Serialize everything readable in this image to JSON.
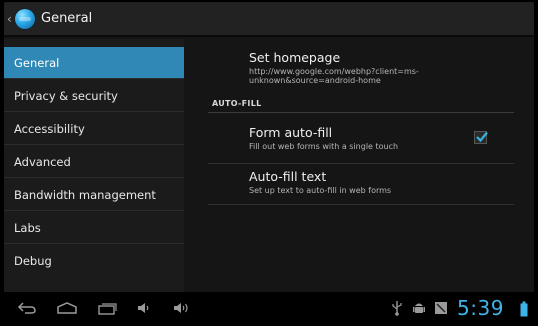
{
  "action_bar": {
    "title": "General"
  },
  "sidebar": {
    "items": [
      {
        "label": "General",
        "active": true
      },
      {
        "label": "Privacy & security"
      },
      {
        "label": "Accessibility"
      },
      {
        "label": "Advanced"
      },
      {
        "label": "Bandwidth management"
      },
      {
        "label": "Labs"
      },
      {
        "label": "Debug"
      }
    ]
  },
  "preferences": {
    "homepage": {
      "title": "Set homepage",
      "summary": "http://www.google.com/webhp?client=ms-unknown&source=android-home"
    },
    "category_autofill": "AUTO-FILL",
    "form_autofill": {
      "title": "Form auto-fill",
      "summary": "Fill out web forms with a single touch",
      "checked": true
    },
    "autofill_text": {
      "title": "Auto-fill text",
      "summary": "Set up text to auto-fill in web forms"
    }
  },
  "status_bar": {
    "time": "5:39"
  },
  "colors": {
    "accent": "#2f88b5",
    "clock": "#3fb3e8",
    "check": "#33b5e5"
  }
}
